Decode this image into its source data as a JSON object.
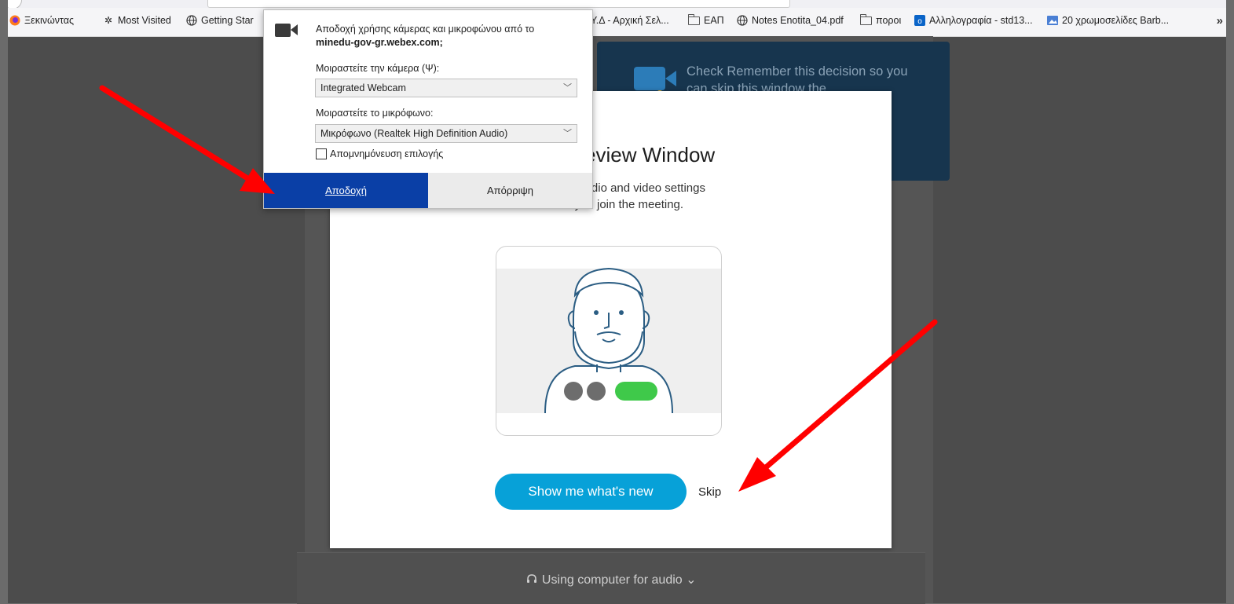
{
  "bookmarks": {
    "items": [
      {
        "label": "Ξεκινώντας",
        "icon": "firefox-icon"
      },
      {
        "label": "Most Visited",
        "icon": "gear-icon"
      },
      {
        "label": "Getting Star",
        "icon": "globe-icon"
      },
      {
        "label": "Y.Δ - Αρχική Σελ...",
        "icon": "none"
      },
      {
        "label": "ΕΑΠ",
        "icon": "folder-icon"
      },
      {
        "label": "Notes Enotita_04.pdf",
        "icon": "globe-icon"
      },
      {
        "label": "ποροι",
        "icon": "folder-icon"
      },
      {
        "label": "Αλληλογραφία - std13...",
        "icon": "outlook-icon"
      },
      {
        "label": "20 χρωμοσελίδες Barb...",
        "icon": "image-icon"
      }
    ],
    "overflow": "»"
  },
  "permission_popup": {
    "question": "Αποδοχή χρήσης κάμερας και μικροφώνου από το",
    "domain": "minedu-gov-gr.webex.com;",
    "camera_label": "Μοιραστείτε την κάμερα (Ψ):",
    "camera_value": "Integrated Webcam",
    "mic_label": "Μοιραστείτε το μικρόφωνο:",
    "mic_value": "Μικρόφωνο (Realtek High Definition Audio)",
    "remember_label": "Απομνημόνευση επιλογής",
    "accept_label": "Αποδοχή",
    "reject_label": "Απόρριψη"
  },
  "tooltip": {
    "text": "Check Remember this decision so you can skip this window the"
  },
  "dialog": {
    "title": "Video Preview Window",
    "description_line1": "Adjust your audio and video settings",
    "description_line2": "before you join the meeting.",
    "primary_button": "Show me what's new",
    "skip_link": "Skip"
  },
  "audio_bar": {
    "text": "Using computer for audio",
    "chevron": "⌄"
  },
  "colors": {
    "accept_blue": "#0a3fa6",
    "webex_blue": "#07a1d8",
    "toggle_green": "#3fc94a",
    "arrow_red": "#ff0000"
  }
}
